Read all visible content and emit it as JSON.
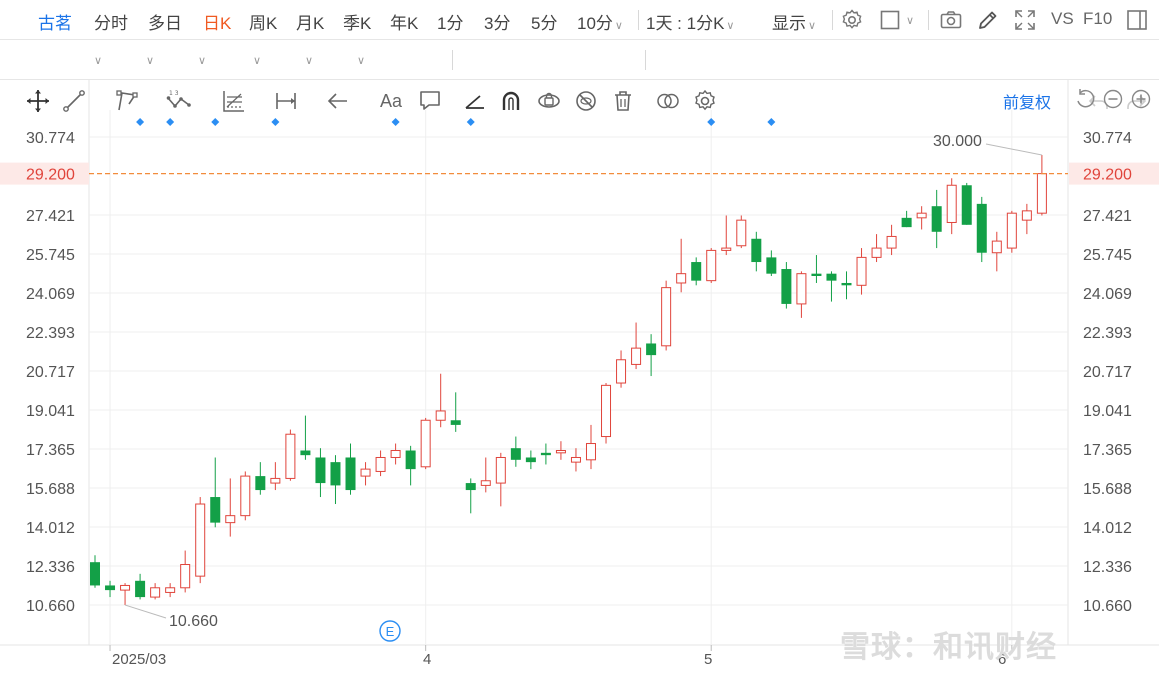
{
  "toolbar": {
    "stock_name": "古茗",
    "periods": [
      "分时",
      "多日",
      "日K",
      "周K",
      "月K",
      "季K",
      "年K",
      "1分",
      "3分",
      "5分",
      "10分"
    ],
    "active_period": "日K",
    "multi_period_label": "1天 : 1分K",
    "display_label": "显示",
    "vs_label": "VS",
    "f10_label": "F10"
  },
  "fuquan_label": "前复权",
  "colors": {
    "up": "#e0443b",
    "down": "#13a047",
    "accent": "#1a73e8",
    "active_tab": "#f05a22",
    "price_line": "#f28c3c",
    "price_label": "#e0443b",
    "event_marker": "#2b8ef3"
  },
  "chart_data": {
    "type": "candlestick",
    "y_ticks": [
      "30.774",
      "29.200",
      "27.421",
      "25.745",
      "24.069",
      "22.393",
      "20.717",
      "19.041",
      "17.365",
      "15.688",
      "14.012",
      "12.336",
      "10.660"
    ],
    "ylim": [
      10.66,
      30.774
    ],
    "x_labels": [
      "2025/03",
      "4",
      "5",
      "6"
    ],
    "current_price": "29.200",
    "max_label": "30.000",
    "min_label": "10.660",
    "event_label": "E",
    "candles": [
      {
        "o": 12.5,
        "h": 12.8,
        "l": 11.4,
        "c": 11.5
      },
      {
        "o": 11.5,
        "h": 11.7,
        "l": 11.0,
        "c": 11.3
      },
      {
        "o": 11.3,
        "h": 11.6,
        "l": 10.66,
        "c": 11.5
      },
      {
        "o": 11.7,
        "h": 12.0,
        "l": 10.9,
        "c": 11.0
      },
      {
        "o": 11.0,
        "h": 11.6,
        "l": 10.9,
        "c": 11.4
      },
      {
        "o": 11.2,
        "h": 11.6,
        "l": 11.0,
        "c": 11.4
      },
      {
        "o": 11.4,
        "h": 13.0,
        "l": 11.2,
        "c": 12.4
      },
      {
        "o": 11.9,
        "h": 15.3,
        "l": 11.6,
        "c": 15.0
      },
      {
        "o": 15.3,
        "h": 17.0,
        "l": 14.0,
        "c": 14.2
      },
      {
        "o": 14.2,
        "h": 16.1,
        "l": 13.6,
        "c": 14.5
      },
      {
        "o": 14.5,
        "h": 16.4,
        "l": 14.3,
        "c": 16.2
      },
      {
        "o": 16.2,
        "h": 16.8,
        "l": 15.4,
        "c": 15.6
      },
      {
        "o": 15.9,
        "h": 16.8,
        "l": 15.6,
        "c": 16.1
      },
      {
        "o": 16.1,
        "h": 18.2,
        "l": 16.0,
        "c": 18.0
      },
      {
        "o": 17.3,
        "h": 18.8,
        "l": 16.9,
        "c": 17.1
      },
      {
        "o": 17.0,
        "h": 17.4,
        "l": 15.3,
        "c": 15.9
      },
      {
        "o": 16.8,
        "h": 17.1,
        "l": 15.0,
        "c": 15.8
      },
      {
        "o": 17.0,
        "h": 17.6,
        "l": 15.4,
        "c": 15.6
      },
      {
        "o": 16.2,
        "h": 16.8,
        "l": 15.8,
        "c": 16.5
      },
      {
        "o": 16.4,
        "h": 17.3,
        "l": 16.2,
        "c": 17.0
      },
      {
        "o": 17.0,
        "h": 17.6,
        "l": 16.7,
        "c": 17.3
      },
      {
        "o": 17.3,
        "h": 17.5,
        "l": 15.8,
        "c": 16.5
      },
      {
        "o": 16.6,
        "h": 18.7,
        "l": 16.5,
        "c": 18.6
      },
      {
        "o": 18.6,
        "h": 20.6,
        "l": 18.3,
        "c": 19.0
      },
      {
        "o": 18.6,
        "h": 19.8,
        "l": 18.1,
        "c": 18.4
      },
      {
        "o": 15.9,
        "h": 16.1,
        "l": 14.6,
        "c": 15.6
      },
      {
        "o": 15.8,
        "h": 17.0,
        "l": 15.5,
        "c": 16.0
      },
      {
        "o": 15.9,
        "h": 17.2,
        "l": 14.9,
        "c": 17.0
      },
      {
        "o": 17.4,
        "h": 17.9,
        "l": 16.6,
        "c": 16.9
      },
      {
        "o": 17.0,
        "h": 17.3,
        "l": 16.5,
        "c": 16.8
      },
      {
        "o": 17.2,
        "h": 17.6,
        "l": 16.7,
        "c": 17.1
      },
      {
        "o": 17.2,
        "h": 17.7,
        "l": 16.9,
        "c": 17.3
      },
      {
        "o": 16.8,
        "h": 17.4,
        "l": 16.4,
        "c": 17.0
      },
      {
        "o": 16.9,
        "h": 18.4,
        "l": 16.5,
        "c": 17.6
      },
      {
        "o": 17.9,
        "h": 20.2,
        "l": 17.6,
        "c": 20.1
      },
      {
        "o": 20.2,
        "h": 21.6,
        "l": 20.0,
        "c": 21.2
      },
      {
        "o": 21.0,
        "h": 22.8,
        "l": 20.8,
        "c": 21.7
      },
      {
        "o": 21.9,
        "h": 22.3,
        "l": 20.5,
        "c": 21.4
      },
      {
        "o": 21.8,
        "h": 24.6,
        "l": 21.6,
        "c": 24.3
      },
      {
        "o": 24.5,
        "h": 26.4,
        "l": 24.1,
        "c": 24.9
      },
      {
        "o": 25.4,
        "h": 25.6,
        "l": 24.4,
        "c": 24.6
      },
      {
        "o": 24.6,
        "h": 26.0,
        "l": 24.5,
        "c": 25.9
      },
      {
        "o": 25.9,
        "h": 27.4,
        "l": 25.7,
        "c": 26.0
      },
      {
        "o": 26.1,
        "h": 27.4,
        "l": 26.0,
        "c": 27.2
      },
      {
        "o": 26.4,
        "h": 26.7,
        "l": 25.0,
        "c": 25.4
      },
      {
        "o": 25.6,
        "h": 25.9,
        "l": 24.8,
        "c": 24.9
      },
      {
        "o": 25.1,
        "h": 25.4,
        "l": 23.4,
        "c": 23.6
      },
      {
        "o": 23.6,
        "h": 25.0,
        "l": 23.0,
        "c": 24.9
      },
      {
        "o": 24.9,
        "h": 25.7,
        "l": 24.5,
        "c": 24.8
      },
      {
        "o": 24.9,
        "h": 25.0,
        "l": 23.7,
        "c": 24.6
      },
      {
        "o": 24.5,
        "h": 25.0,
        "l": 23.8,
        "c": 24.4
      },
      {
        "o": 24.4,
        "h": 26.0,
        "l": 24.0,
        "c": 25.6
      },
      {
        "o": 25.6,
        "h": 26.6,
        "l": 25.4,
        "c": 26.0
      },
      {
        "o": 26.0,
        "h": 27.0,
        "l": 25.7,
        "c": 26.5
      },
      {
        "o": 27.3,
        "h": 27.6,
        "l": 26.9,
        "c": 26.9
      },
      {
        "o": 27.3,
        "h": 27.8,
        "l": 26.8,
        "c": 27.5
      },
      {
        "o": 27.8,
        "h": 28.5,
        "l": 26.0,
        "c": 26.7
      },
      {
        "o": 27.1,
        "h": 29.0,
        "l": 26.6,
        "c": 28.7
      },
      {
        "o": 28.7,
        "h": 28.8,
        "l": 27.0,
        "c": 27.0
      },
      {
        "o": 27.9,
        "h": 28.2,
        "l": 25.4,
        "c": 25.8
      },
      {
        "o": 25.8,
        "h": 26.7,
        "l": 25.0,
        "c": 26.3
      },
      {
        "o": 26.0,
        "h": 27.6,
        "l": 25.8,
        "c": 27.5
      },
      {
        "o": 27.2,
        "h": 27.9,
        "l": 26.6,
        "c": 27.6
      },
      {
        "o": 27.5,
        "h": 30.0,
        "l": 27.4,
        "c": 29.2
      }
    ],
    "event_candle_indices": [
      3,
      5,
      8,
      12,
      20,
      25,
      41,
      45
    ]
  },
  "watermark": "雪球：和讯财经"
}
